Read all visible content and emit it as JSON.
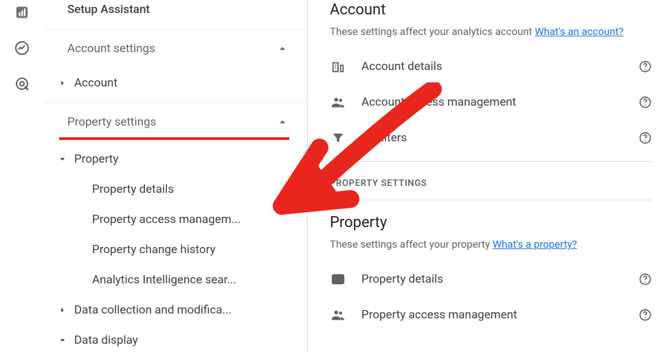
{
  "rail": {
    "icons": [
      "chart-bar",
      "donut-trend",
      "click-target"
    ]
  },
  "sidebar": {
    "setup": "Setup Assistant",
    "account_settings": {
      "label": "Account settings"
    },
    "account_item": "Account",
    "property_settings": {
      "label": "Property settings"
    },
    "property_item": "Property",
    "property_children": [
      "Property details",
      "Property access managem...",
      "Property change history",
      "Analytics Intelligence sear..."
    ],
    "data_collection": "Data collection and modifica...",
    "data_display": "Data display"
  },
  "main": {
    "account": {
      "title": "Account",
      "desc": "These settings affect your analytics account ",
      "link": "What's an account?",
      "rows": [
        {
          "icon": "building",
          "label": "Account details"
        },
        {
          "icon": "people",
          "label": "Account access management"
        },
        {
          "icon": "filter",
          "label": "All filters"
        }
      ]
    },
    "property_heading": "PROPERTY SETTINGS",
    "property": {
      "title": "Property",
      "desc": "These settings affect your property ",
      "link": "What's a property?",
      "rows": [
        {
          "icon": "card",
          "label": "Property details"
        },
        {
          "icon": "people",
          "label": "Property access management"
        }
      ]
    }
  },
  "colors": {
    "accent_red": "#e8261d",
    "link": "#1a73e8"
  }
}
